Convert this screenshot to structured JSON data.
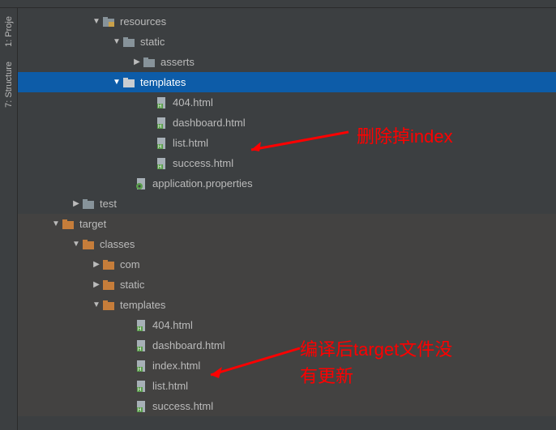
{
  "side_tabs": {
    "project": "1: Proje",
    "structure": "7: Structure"
  },
  "tree": {
    "resources": {
      "label": "resources",
      "static": {
        "label": "static",
        "asserts": "asserts"
      },
      "templates": {
        "label": "templates",
        "files": [
          "404.html",
          "dashboard.html",
          "list.html",
          "success.html"
        ]
      },
      "app_props": "application.properties"
    },
    "test": "test",
    "target": {
      "label": "target",
      "classes": {
        "label": "classes",
        "com": "com",
        "static": "static",
        "templates": {
          "label": "templates",
          "files": [
            "404.html",
            "dashboard.html",
            "index.html",
            "list.html",
            "success.html"
          ]
        }
      }
    }
  },
  "annotations": {
    "anno1": "删除掉index",
    "anno2_line1": "编译后target文件没",
    "anno2_line2": "有更新"
  }
}
